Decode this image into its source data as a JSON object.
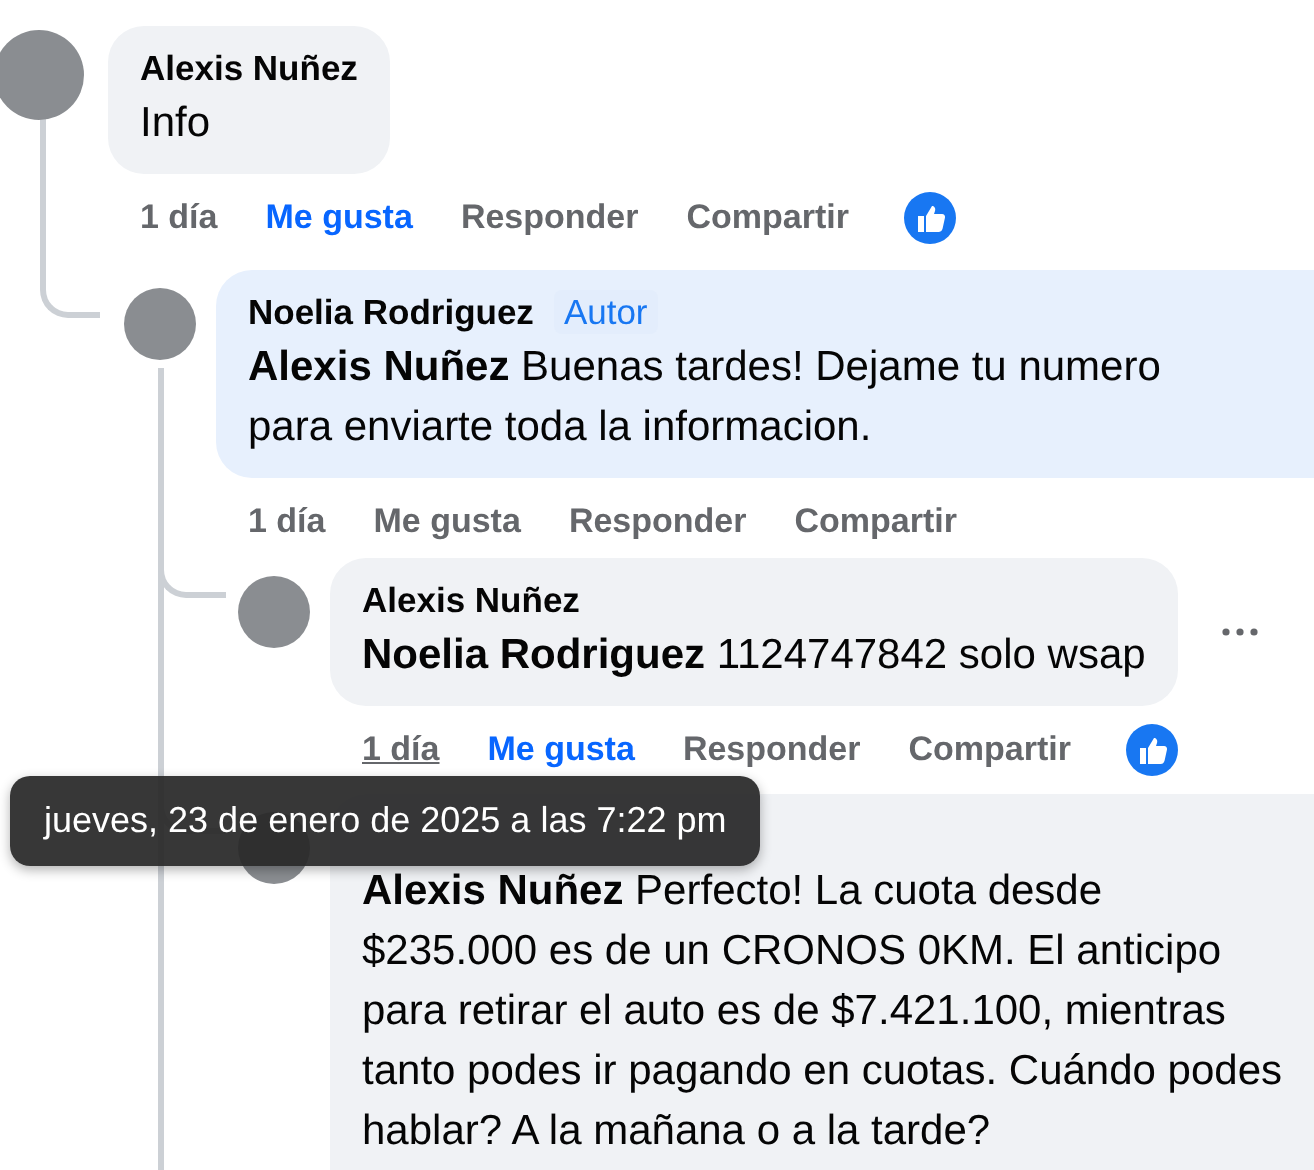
{
  "comments": [
    {
      "author": "Alexis Nuñez",
      "text": "Info",
      "time": "1 día",
      "time_hovered": false,
      "like_label": "Me gusta",
      "liked": true,
      "reply_label": "Responder",
      "share_label": "Compartir",
      "reaction_icon": true,
      "more_menu": false,
      "color": "#f0f2f5",
      "children": [
        {
          "author": "Noelia Rodriguez",
          "badge": "Autor",
          "text": "**Alexis Nuñez** Buenas tardes! Dejame tu numero para enviarte toda la informacion.",
          "time": "1 día",
          "time_hovered": false,
          "like_label": "Me gusta",
          "liked": false,
          "reply_label": "Responder",
          "share_label": "Compartir",
          "reaction_icon": false,
          "more_menu": false,
          "color": "#e7f0fd",
          "children": [
            {
              "author": "Alexis Nuñez",
              "text": "**Noelia Rodriguez** 1124747842 solo wsap",
              "time": "1 día",
              "time_hovered": true,
              "like_label": "Me gusta",
              "liked": true,
              "reply_label": "Responder",
              "share_label": "Compartir",
              "reaction_icon": true,
              "more_menu": true,
              "color": "#f0f2f5"
            },
            {
              "text": "**Alexis Nuñez** Perfecto! La cuota desde $235.000 es de un CRONOS 0KM. El anticipo para retirar el auto es de $7.421.100, mientras tanto podes ir pagando en cuotas. Cuándo podes hablar? A la mañana o a la tarde?",
              "more_menu": false,
              "color": "#f0f2f5"
            }
          ]
        }
      ]
    }
  ],
  "tooltip": {
    "text": "jueves, 23 de enero de 2025 a las 7:22 pm"
  }
}
